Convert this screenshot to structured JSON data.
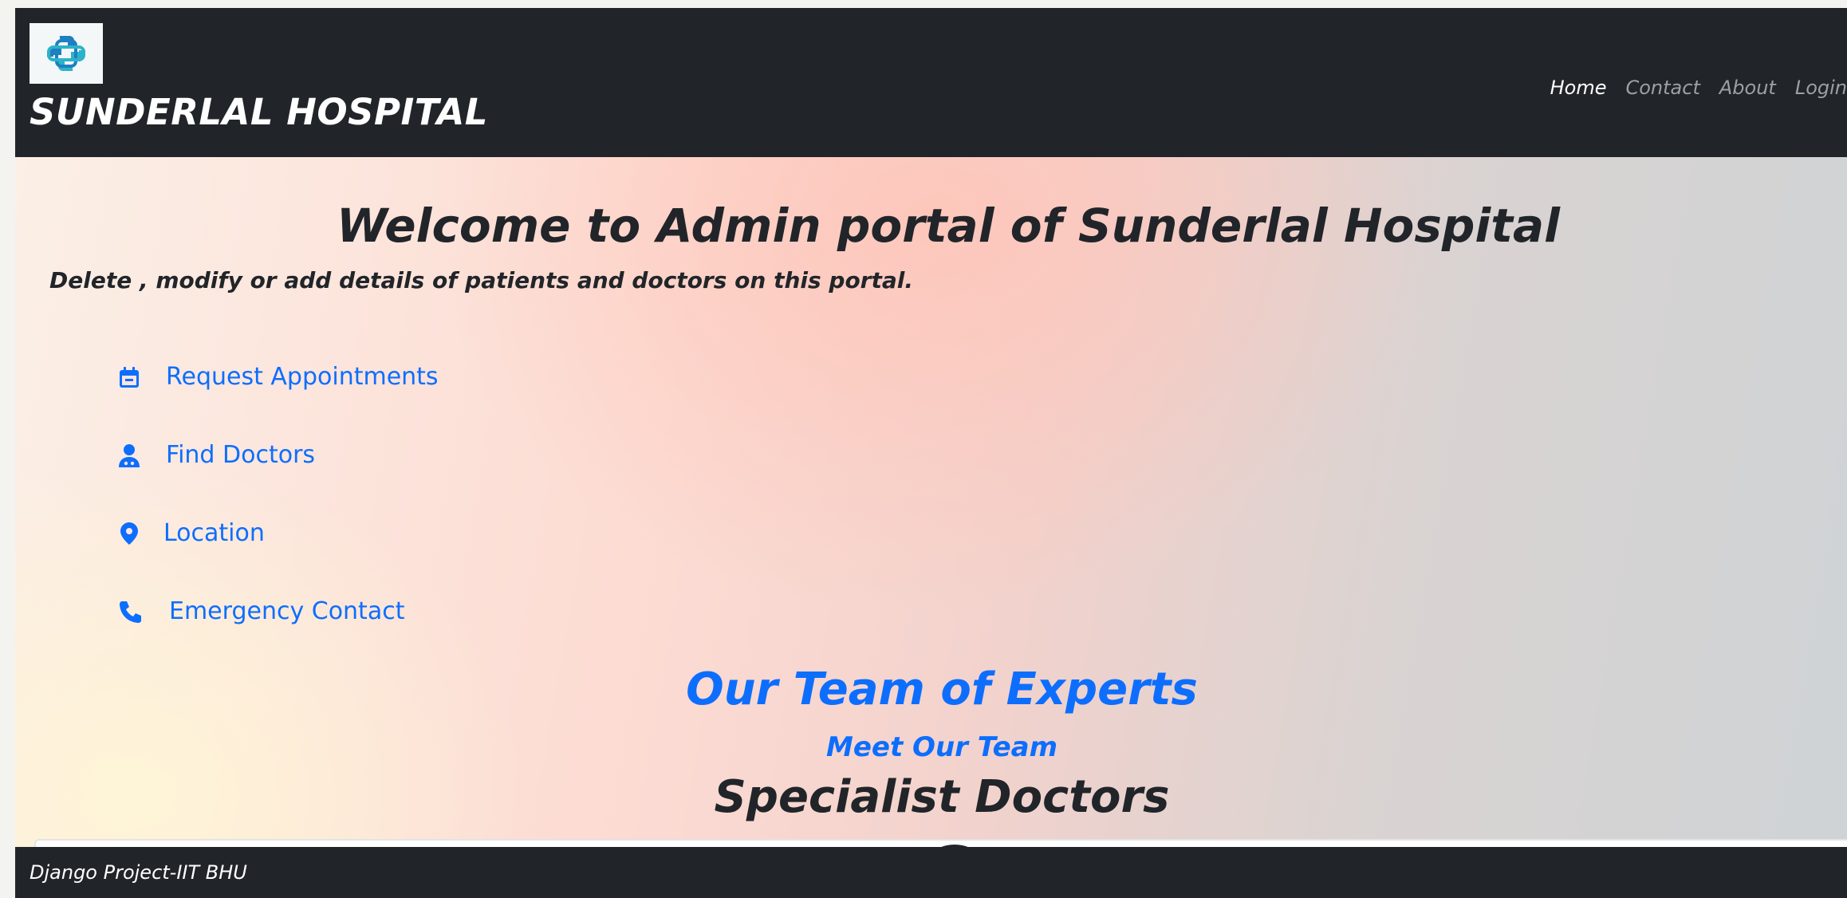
{
  "navbar": {
    "brand": "SUNDERLAL HOSPITAL",
    "logo_icon": "medical-cross-logo",
    "links": [
      {
        "label": "Home",
        "active": true
      },
      {
        "label": "Contact",
        "active": false
      },
      {
        "label": "About",
        "active": false
      },
      {
        "label": "Login",
        "active": false
      }
    ]
  },
  "main": {
    "welcome": "Welcome to Admin portal of Sunderlal Hospital",
    "subtitle": "Delete , modify or add details of patients and doctors on this portal.",
    "quick_links": [
      {
        "label": "Request Appointments",
        "icon": "calendar-icon"
      },
      {
        "label": "Find Doctors",
        "icon": "doctor-icon"
      },
      {
        "label": "Location",
        "icon": "location-pin-icon"
      },
      {
        "label": "Emergency Contact",
        "icon": "phone-icon"
      }
    ],
    "team_title": "Our Team of Experts",
    "team_subtitle": "Meet Our Team",
    "specialist_heading": "Specialist Doctors"
  },
  "footer": {
    "text": "Django Project-IIT BHU"
  },
  "colors": {
    "navbar_bg": "#212529",
    "link_blue": "#0d6efd",
    "nav_active": "#ffffff",
    "nav_inactive": "#9aa0a6"
  }
}
